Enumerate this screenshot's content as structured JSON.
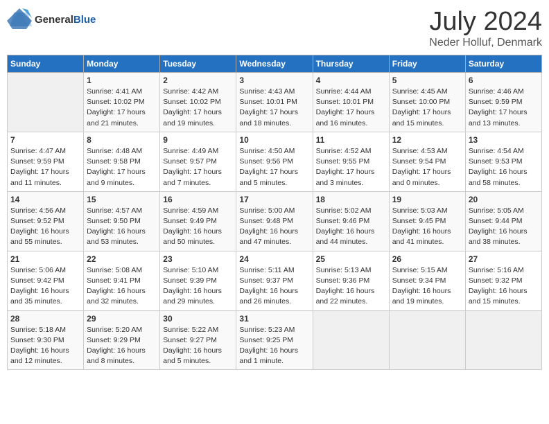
{
  "header": {
    "logo_general": "General",
    "logo_blue": "Blue",
    "title": "July 2024",
    "location": "Neder Holluf, Denmark"
  },
  "days_of_week": [
    "Sunday",
    "Monday",
    "Tuesday",
    "Wednesday",
    "Thursday",
    "Friday",
    "Saturday"
  ],
  "weeks": [
    [
      {
        "day": "",
        "info": ""
      },
      {
        "day": "1",
        "info": "Sunrise: 4:41 AM\nSunset: 10:02 PM\nDaylight: 17 hours\nand 21 minutes."
      },
      {
        "day": "2",
        "info": "Sunrise: 4:42 AM\nSunset: 10:02 PM\nDaylight: 17 hours\nand 19 minutes."
      },
      {
        "day": "3",
        "info": "Sunrise: 4:43 AM\nSunset: 10:01 PM\nDaylight: 17 hours\nand 18 minutes."
      },
      {
        "day": "4",
        "info": "Sunrise: 4:44 AM\nSunset: 10:01 PM\nDaylight: 17 hours\nand 16 minutes."
      },
      {
        "day": "5",
        "info": "Sunrise: 4:45 AM\nSunset: 10:00 PM\nDaylight: 17 hours\nand 15 minutes."
      },
      {
        "day": "6",
        "info": "Sunrise: 4:46 AM\nSunset: 9:59 PM\nDaylight: 17 hours\nand 13 minutes."
      }
    ],
    [
      {
        "day": "7",
        "info": "Sunrise: 4:47 AM\nSunset: 9:59 PM\nDaylight: 17 hours\nand 11 minutes."
      },
      {
        "day": "8",
        "info": "Sunrise: 4:48 AM\nSunset: 9:58 PM\nDaylight: 17 hours\nand 9 minutes."
      },
      {
        "day": "9",
        "info": "Sunrise: 4:49 AM\nSunset: 9:57 PM\nDaylight: 17 hours\nand 7 minutes."
      },
      {
        "day": "10",
        "info": "Sunrise: 4:50 AM\nSunset: 9:56 PM\nDaylight: 17 hours\nand 5 minutes."
      },
      {
        "day": "11",
        "info": "Sunrise: 4:52 AM\nSunset: 9:55 PM\nDaylight: 17 hours\nand 3 minutes."
      },
      {
        "day": "12",
        "info": "Sunrise: 4:53 AM\nSunset: 9:54 PM\nDaylight: 17 hours\nand 0 minutes."
      },
      {
        "day": "13",
        "info": "Sunrise: 4:54 AM\nSunset: 9:53 PM\nDaylight: 16 hours\nand 58 minutes."
      }
    ],
    [
      {
        "day": "14",
        "info": "Sunrise: 4:56 AM\nSunset: 9:52 PM\nDaylight: 16 hours\nand 55 minutes."
      },
      {
        "day": "15",
        "info": "Sunrise: 4:57 AM\nSunset: 9:50 PM\nDaylight: 16 hours\nand 53 minutes."
      },
      {
        "day": "16",
        "info": "Sunrise: 4:59 AM\nSunset: 9:49 PM\nDaylight: 16 hours\nand 50 minutes."
      },
      {
        "day": "17",
        "info": "Sunrise: 5:00 AM\nSunset: 9:48 PM\nDaylight: 16 hours\nand 47 minutes."
      },
      {
        "day": "18",
        "info": "Sunrise: 5:02 AM\nSunset: 9:46 PM\nDaylight: 16 hours\nand 44 minutes."
      },
      {
        "day": "19",
        "info": "Sunrise: 5:03 AM\nSunset: 9:45 PM\nDaylight: 16 hours\nand 41 minutes."
      },
      {
        "day": "20",
        "info": "Sunrise: 5:05 AM\nSunset: 9:44 PM\nDaylight: 16 hours\nand 38 minutes."
      }
    ],
    [
      {
        "day": "21",
        "info": "Sunrise: 5:06 AM\nSunset: 9:42 PM\nDaylight: 16 hours\nand 35 minutes."
      },
      {
        "day": "22",
        "info": "Sunrise: 5:08 AM\nSunset: 9:41 PM\nDaylight: 16 hours\nand 32 minutes."
      },
      {
        "day": "23",
        "info": "Sunrise: 5:10 AM\nSunset: 9:39 PM\nDaylight: 16 hours\nand 29 minutes."
      },
      {
        "day": "24",
        "info": "Sunrise: 5:11 AM\nSunset: 9:37 PM\nDaylight: 16 hours\nand 26 minutes."
      },
      {
        "day": "25",
        "info": "Sunrise: 5:13 AM\nSunset: 9:36 PM\nDaylight: 16 hours\nand 22 minutes."
      },
      {
        "day": "26",
        "info": "Sunrise: 5:15 AM\nSunset: 9:34 PM\nDaylight: 16 hours\nand 19 minutes."
      },
      {
        "day": "27",
        "info": "Sunrise: 5:16 AM\nSunset: 9:32 PM\nDaylight: 16 hours\nand 15 minutes."
      }
    ],
    [
      {
        "day": "28",
        "info": "Sunrise: 5:18 AM\nSunset: 9:30 PM\nDaylight: 16 hours\nand 12 minutes."
      },
      {
        "day": "29",
        "info": "Sunrise: 5:20 AM\nSunset: 9:29 PM\nDaylight: 16 hours\nand 8 minutes."
      },
      {
        "day": "30",
        "info": "Sunrise: 5:22 AM\nSunset: 9:27 PM\nDaylight: 16 hours\nand 5 minutes."
      },
      {
        "day": "31",
        "info": "Sunrise: 5:23 AM\nSunset: 9:25 PM\nDaylight: 16 hours\nand 1 minute."
      },
      {
        "day": "",
        "info": ""
      },
      {
        "day": "",
        "info": ""
      },
      {
        "day": "",
        "info": ""
      }
    ]
  ]
}
